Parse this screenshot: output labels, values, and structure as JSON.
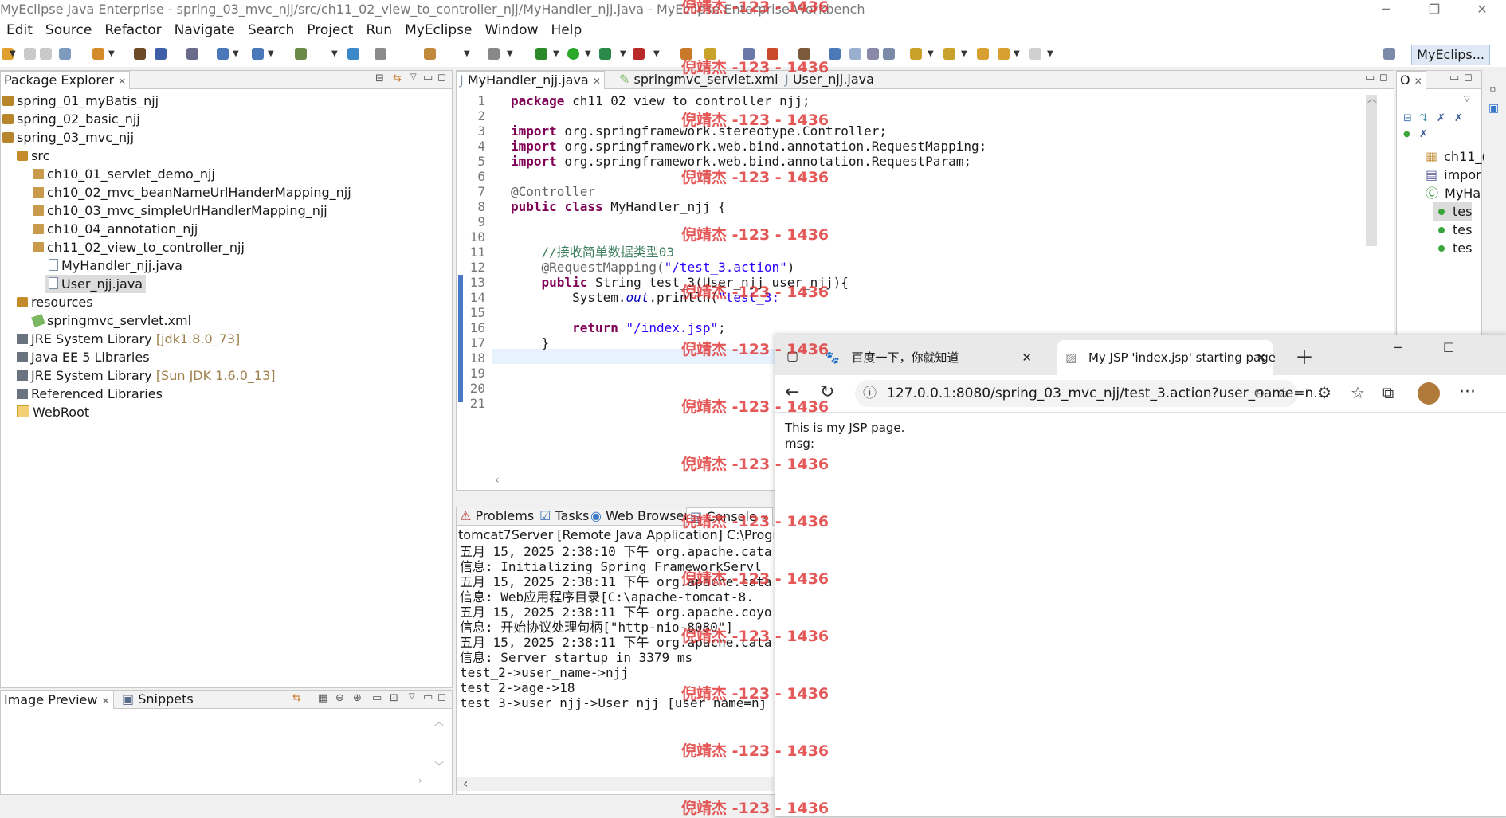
{
  "window": {
    "title": "MyEclipse Java Enterprise - spring_03_mvc_njj/src/ch11_02_view_to_controller_njj/MyHandler_njj.java - MyEclipse Enterprise Workbench"
  },
  "menu": [
    "Edit",
    "Source",
    "Refactor",
    "Navigate",
    "Search",
    "Project",
    "Run",
    "MyEclipse",
    "Window",
    "Help"
  ],
  "perspective": "MyEclips...",
  "package_explorer": {
    "title": "Package Explorer",
    "items": [
      {
        "label": "spring_01_myBatis_njj",
        "extra": ""
      },
      {
        "label": "spring_02_basic_njj",
        "extra": ""
      },
      {
        "label": "spring_03_mvc_njj",
        "extra": ""
      },
      {
        "label": "src",
        "extra": ""
      },
      {
        "label": "ch10_01_servlet_demo_njj",
        "extra": ""
      },
      {
        "label": "ch10_02_mvc_beanNameUrlHanderMapping_njj",
        "extra": ""
      },
      {
        "label": "ch10_03_mvc_simpleUrlHandlerMapping_njj",
        "extra": ""
      },
      {
        "label": "ch10_04_annotation_njj",
        "extra": ""
      },
      {
        "label": "ch11_02_view_to_controller_njj",
        "extra": ""
      },
      {
        "label": "MyHandler_njj.java",
        "extra": ""
      },
      {
        "label": "User_njj.java",
        "extra": ""
      },
      {
        "label": "resources",
        "extra": ""
      },
      {
        "label": "springmvc_servlet.xml",
        "extra": ""
      },
      {
        "label": "JRE System Library ",
        "extra": "[jdk1.8.0_73]"
      },
      {
        "label": "Java EE 5 Libraries",
        "extra": ""
      },
      {
        "label": "JRE System Library ",
        "extra": "[Sun JDK 1.6.0_13]"
      },
      {
        "label": "Referenced Libraries",
        "extra": ""
      },
      {
        "label": "WebRoot",
        "extra": ""
      }
    ]
  },
  "bottom_left": {
    "tab1": "Image Preview",
    "tab2": "Snippets"
  },
  "editor": {
    "tabs": [
      "MyHandler_njj.java",
      "springmvc_servlet.xml",
      "User_njj.java"
    ],
    "line_numbers": [
      "1",
      "2",
      "3",
      "4",
      "5",
      "6",
      "7",
      "8",
      "9",
      "10",
      "11",
      "12",
      "13",
      "14",
      "15",
      "16",
      "17",
      "18",
      "19",
      "20",
      "21"
    ],
    "lines": [
      [
        {
          "t": "package",
          "c": "kw"
        },
        {
          "t": " ch11_02_view_to_controller_njj;",
          "c": ""
        }
      ],
      [],
      [
        {
          "t": "import",
          "c": "kw"
        },
        {
          "t": " org.springframework.stereotype.Controller;",
          "c": ""
        }
      ],
      [
        {
          "t": "import",
          "c": "kw"
        },
        {
          "t": " org.springframework.web.bind.annotation.RequestMapping;",
          "c": ""
        }
      ],
      [
        {
          "t": "import",
          "c": "kw"
        },
        {
          "t": " org.springframework.web.bind.annotation.RequestParam;",
          "c": ""
        }
      ],
      [],
      [
        {
          "t": "@Controller",
          "c": "ann"
        }
      ],
      [
        {
          "t": "public",
          "c": "kw"
        },
        {
          "t": " ",
          "c": ""
        },
        {
          "t": "class",
          "c": "kw"
        },
        {
          "t": " MyHandler_njj {",
          "c": ""
        }
      ],
      [],
      [],
      [
        {
          "t": "    //接收简单数据类型03",
          "c": "cm"
        }
      ],
      [
        {
          "t": "    @RequestMapping(",
          "c": "ann"
        },
        {
          "t": "\"/test_3.action\"",
          "c": "str"
        },
        {
          "t": ")",
          "c": ""
        }
      ],
      [
        {
          "t": "    ",
          "c": ""
        },
        {
          "t": "public",
          "c": "kw"
        },
        {
          "t": " String test_3(User_njj user_njj){",
          "c": ""
        }
      ],
      [
        {
          "t": "        System.",
          "c": ""
        },
        {
          "t": "out",
          "c": "fld"
        },
        {
          "t": ".println(",
          "c": ""
        },
        {
          "t": "\"test_3:",
          "c": "str"
        }
      ],
      [],
      [
        {
          "t": "        ",
          "c": ""
        },
        {
          "t": "return",
          "c": "kw"
        },
        {
          "t": " ",
          "c": ""
        },
        {
          "t": "\"/index.jsp\"",
          "c": "str"
        },
        {
          "t": ";",
          "c": ""
        }
      ],
      [
        {
          "t": "    }",
          "c": ""
        }
      ],
      [],
      [],
      [],
      []
    ]
  },
  "console": {
    "tabs": [
      "Problems",
      "Tasks",
      "Web Browser",
      "Console"
    ],
    "header": "tomcat7Server [Remote Java Application] C:\\Program F",
    "lines": [
      "五月 15, 2025 2:38:10 下午 org.apache.cata",
      "信息: Initializing Spring FrameworkServl",
      "五月 15, 2025 2:38:11 下午 org.apache.cata",
      "信息: Web应用程序目录[C:\\apache-tomcat-8.",
      "五月 15, 2025 2:38:11 下午 org.apache.coyo",
      "信息: 开始协议处理句柄[\"http-nio-8080\"]",
      "五月 15, 2025 2:38:11 下午 org.apache.cata",
      "信息: Server startup in 3379 ms",
      "test_2->user_name->njj",
      "test_2->age->18",
      "test_3->user_njj->User_njj [user_name=nj"
    ]
  },
  "outline": {
    "items": [
      "ch11_(",
      "impor",
      "MyHa",
      "tes",
      "tes",
      "tes"
    ]
  },
  "browser": {
    "tab1": "百度一下，你就知道",
    "tab2": "My JSP 'index.jsp' starting page",
    "url": "127.0.0.1:8080/spring_03_mvc_njj/test_3.action?user_name=n...",
    "content_line1": "This is my JSP page.",
    "content_line2": "msg:"
  },
  "watermark": "倪靖杰 -123 - 1436"
}
